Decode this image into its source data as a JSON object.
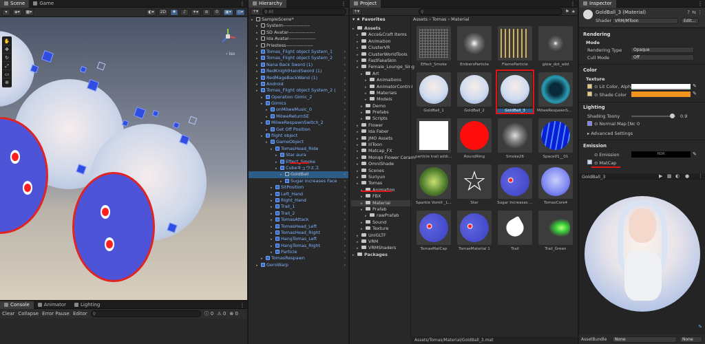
{
  "scene": {
    "tab_scene": "Scene",
    "tab_game": "Game",
    "iso_label": "‹ Iso",
    "toolbar": {
      "mode_2d": "2D",
      "gizmo_count": "0"
    }
  },
  "console": {
    "tab_console": "Console",
    "tab_animator": "Animator",
    "tab_lighting": "Lighting",
    "clear": "Clear",
    "collapse": "Collapse",
    "error_pause": "Error Pause",
    "editor": "Editor",
    "count_warn": "0",
    "count_info": "0",
    "count_err": "0"
  },
  "hierarchy": {
    "title": "Hierarchy",
    "search_placeholder": "All",
    "items": [
      {
        "label": "SampleScene*",
        "depth": 0,
        "kind": "scene"
      },
      {
        "label": "System-----------------",
        "depth": 1,
        "kind": "obj"
      },
      {
        "label": "SD Avatar-----------------",
        "depth": 1,
        "kind": "obj"
      },
      {
        "label": "Ida Avatar-----------------",
        "depth": 1,
        "kind": "obj"
      },
      {
        "label": "Priestess-----------------",
        "depth": 1,
        "kind": "obj"
      },
      {
        "label": "Tomas_Flight object System_1",
        "depth": 1,
        "kind": "blue"
      },
      {
        "label": "Tomas_Flight object System_2",
        "depth": 1,
        "kind": "blue"
      },
      {
        "label": "Nana Back Sword (1)",
        "depth": 1,
        "kind": "blue"
      },
      {
        "label": "RedKnightHandSword (1)",
        "depth": 1,
        "kind": "blue"
      },
      {
        "label": "RedMageBackWand (1)",
        "depth": 1,
        "kind": "blue"
      },
      {
        "label": "Android",
        "depth": 1,
        "kind": "blue"
      },
      {
        "label": "Tomas_Flight object System_2 (",
        "depth": 1,
        "kind": "blue"
      },
      {
        "label": "Operation Gimic_2",
        "depth": 2,
        "kind": "blue"
      },
      {
        "label": "Gimics",
        "depth": 2,
        "kind": "blue"
      },
      {
        "label": "onMöweMusic_0",
        "depth": 3,
        "kind": "blue"
      },
      {
        "label": "MöweReturnSE",
        "depth": 3,
        "kind": "blue"
      },
      {
        "label": "MöweRespawnSwitch_2",
        "depth": 2,
        "kind": "blue"
      },
      {
        "label": "Get Off Position",
        "depth": 3,
        "kind": "blue"
      },
      {
        "label": "flight object",
        "depth": 2,
        "kind": "blue"
      },
      {
        "label": "GameObject",
        "depth": 3,
        "kind": "blue"
      },
      {
        "label": "TomasHead_Ride",
        "depth": 4,
        "kind": "blue"
      },
      {
        "label": "Star aura",
        "depth": 5,
        "kind": "blue"
      },
      {
        "label": "Effect_Smoke",
        "depth": 5,
        "kind": "blue"
      },
      {
        "label": "Cubeキュウエス",
        "depth": 5,
        "kind": "blue"
      },
      {
        "label": "GoldBall",
        "depth": 6,
        "kind": "sel"
      },
      {
        "label": "Sugar Increases Face",
        "depth": 6,
        "kind": "blue"
      },
      {
        "label": "SitPosition",
        "depth": 4,
        "kind": "blue"
      },
      {
        "label": "Left_Hand",
        "depth": 4,
        "kind": "blue"
      },
      {
        "label": "Right_Hand",
        "depth": 4,
        "kind": "blue"
      },
      {
        "label": "Trail_1",
        "depth": 4,
        "kind": "blue"
      },
      {
        "label": "Trail_2",
        "depth": 4,
        "kind": "blue"
      },
      {
        "label": "TomasAttack",
        "depth": 4,
        "kind": "blue"
      },
      {
        "label": "TomasHead_Left",
        "depth": 4,
        "kind": "blue"
      },
      {
        "label": "TomasHead_Right",
        "depth": 4,
        "kind": "blue"
      },
      {
        "label": "HangTomas_Left",
        "depth": 4,
        "kind": "blue"
      },
      {
        "label": "HangTomas_Right",
        "depth": 4,
        "kind": "blue"
      },
      {
        "label": "Particle",
        "depth": 4,
        "kind": "blue"
      },
      {
        "label": "TomasRespawn",
        "depth": 2,
        "kind": "blue"
      },
      {
        "label": "GeroWarp",
        "depth": 1,
        "kind": "blue"
      }
    ]
  },
  "project": {
    "title": "Project",
    "favorites": "Favorites",
    "breadcrumb": [
      "Assets",
      "Tomas",
      "Material"
    ],
    "tree": [
      {
        "label": "Assets",
        "depth": 0,
        "bold": true
      },
      {
        "label": "Acce&Craft Items",
        "depth": 1
      },
      {
        "label": "Animation",
        "depth": 1
      },
      {
        "label": "ClusterVR",
        "depth": 1
      },
      {
        "label": "ClusterWorldTools",
        "depth": 1
      },
      {
        "label": "FastFakeSkin",
        "depth": 1
      },
      {
        "label": "Female_Lounge_Sing",
        "depth": 1
      },
      {
        "label": "Art",
        "depth": 2
      },
      {
        "label": "Animations",
        "depth": 3
      },
      {
        "label": "AnimatorControl",
        "depth": 3
      },
      {
        "label": "Materials",
        "depth": 3
      },
      {
        "label": "Models",
        "depth": 3
      },
      {
        "label": "Demo",
        "depth": 2
      },
      {
        "label": "Prefabs",
        "depth": 2
      },
      {
        "label": "Scripts",
        "depth": 2
      },
      {
        "label": "Flower",
        "depth": 1
      },
      {
        "label": "Ida Faber",
        "depth": 1
      },
      {
        "label": "JMO Assets",
        "depth": 1
      },
      {
        "label": "lilToon",
        "depth": 1
      },
      {
        "label": "Matcap_FX",
        "depth": 1
      },
      {
        "label": "Monqo Flower Ceram",
        "depth": 1
      },
      {
        "label": "OmniShade",
        "depth": 1
      },
      {
        "label": "Scenes",
        "depth": 1
      },
      {
        "label": "Suriyun",
        "depth": 1
      },
      {
        "label": "Tomas",
        "depth": 1
      },
      {
        "label": "Animation",
        "depth": 2
      },
      {
        "label": "FBX",
        "depth": 2
      },
      {
        "label": "Material",
        "depth": 2,
        "sel": true
      },
      {
        "label": "Prafab",
        "depth": 2
      },
      {
        "label": "rawPrafab",
        "depth": 3
      },
      {
        "label": "Sound",
        "depth": 2
      },
      {
        "label": "Texture",
        "depth": 2
      },
      {
        "label": "UniGLTF",
        "depth": 1
      },
      {
        "label": "VRM",
        "depth": 1
      },
      {
        "label": "VRMShaders",
        "depth": 1
      },
      {
        "label": "Packages",
        "depth": 0,
        "bold": true
      }
    ],
    "assets": [
      "Effect_Smoke",
      "EmbersParticle",
      "FlameParticle",
      "glow_dot_add",
      "GoldBall_1",
      "GoldBall_2",
      "GoldBall_3",
      "MöweRespawnSw...",
      "particle trail addit...",
      "RoundRing",
      "Smoke26",
      "Space01__01",
      "Sparkle Vomit _L...",
      "Star",
      "Sugar Increases ...",
      "TomasCore4",
      "TomasMatCap",
      "TomasMaterial 1",
      "Trail",
      "Trail_Green"
    ],
    "footer_path": "Assets/Tomas/Material/GoldBall_3.mat"
  },
  "inspector": {
    "title": "Inspector",
    "material_name": "GoldBall_3 (Material)",
    "shader_label": "Shader",
    "shader_value": "VRM/MToon",
    "edit_button": "Edit...",
    "rendering": "Rendering",
    "mode": "Mode",
    "rendering_type": "Rendering Type",
    "rendering_type_value": "Opaque",
    "cull_mode": "Cull Mode",
    "cull_mode_value": "Off",
    "color": "Color",
    "texture": "Texture",
    "lit_color": "Lit Color, Alpha",
    "shade_color": "Shade Color",
    "lighting": "Lighting",
    "shading_toony": "Shading Toony",
    "shading_toony_value": "0.9",
    "normal_map": "Normal Map [Nc",
    "normal_map_value": "0",
    "advanced_settings": "Advanced Settings",
    "emission": "Emission",
    "emission_label": "Emission",
    "hdr": "HDR",
    "matcap": "MatCap",
    "preview_title": "GoldBall_3",
    "asset_bundle": "AssetBundle",
    "asset_bundle_value": "None",
    "variant_value": "None",
    "colors": {
      "lit": "#ffffff",
      "shade": "#f0941e",
      "accent": "#e01515",
      "selection": "#2c5d87"
    }
  }
}
